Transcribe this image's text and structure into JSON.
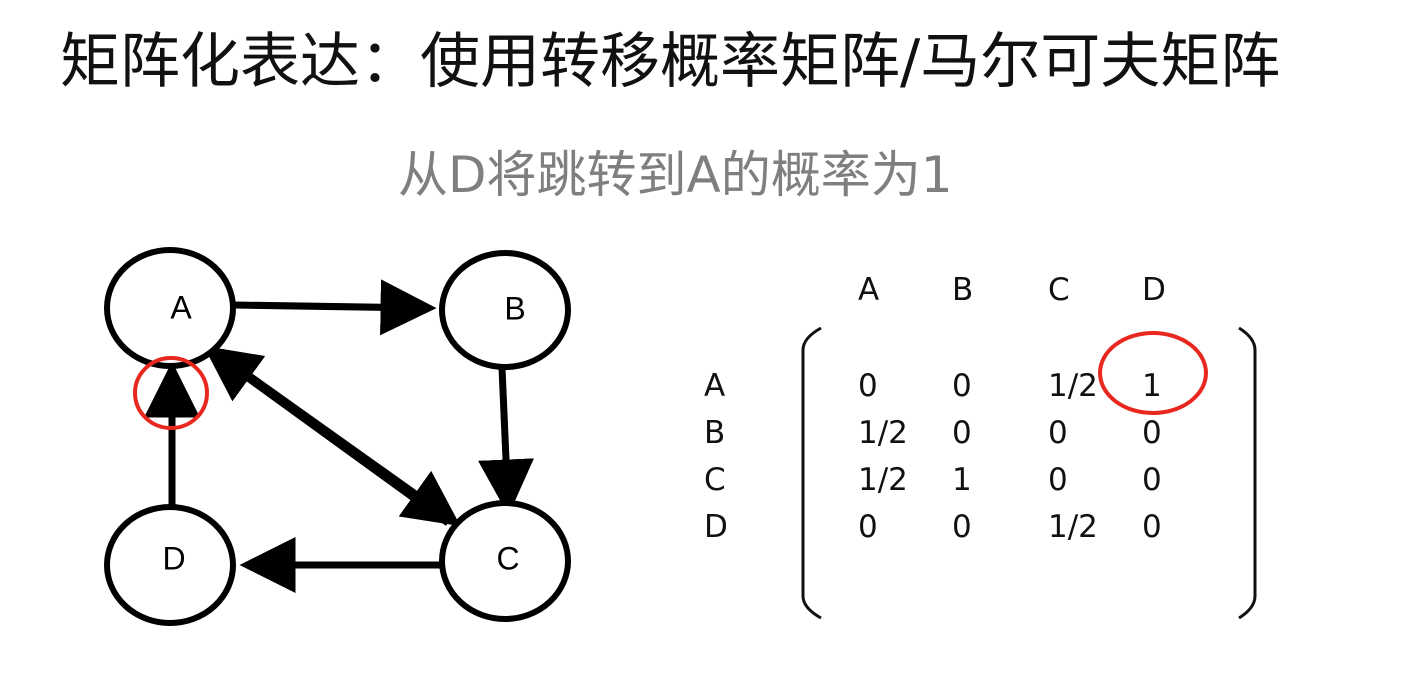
{
  "title": "矩阵化表达：使用转移概率矩阵/马尔可夫矩阵",
  "subtitle": "从D将跳转到A的概率为1",
  "colors": {
    "highlight": "#e8281e",
    "subtitle": "#7f7f7f",
    "stroke": "#000000"
  },
  "graph": {
    "nodes": [
      "A",
      "B",
      "C",
      "D"
    ],
    "edges": [
      {
        "from": "A",
        "to": "B"
      },
      {
        "from": "B",
        "to": "C"
      },
      {
        "from": "C",
        "to": "D"
      },
      {
        "from": "D",
        "to": "A"
      },
      {
        "from": "A",
        "to": "C"
      },
      {
        "from": "C",
        "to": "A"
      }
    ],
    "highlighted_edge": {
      "from": "D",
      "to": "A"
    }
  },
  "matrix": {
    "col_headers": [
      "A",
      "B",
      "C",
      "D"
    ],
    "row_headers": [
      "A",
      "B",
      "C",
      "D"
    ],
    "rows": [
      [
        "0",
        "0",
        "1/2",
        "1"
      ],
      [
        "1/2",
        "0",
        "0",
        "0"
      ],
      [
        "1/2",
        "1",
        "0",
        "0"
      ],
      [
        "0",
        "0",
        "1/2",
        "0"
      ]
    ],
    "highlighted_cell": {
      "row": "A",
      "col": "D"
    }
  }
}
